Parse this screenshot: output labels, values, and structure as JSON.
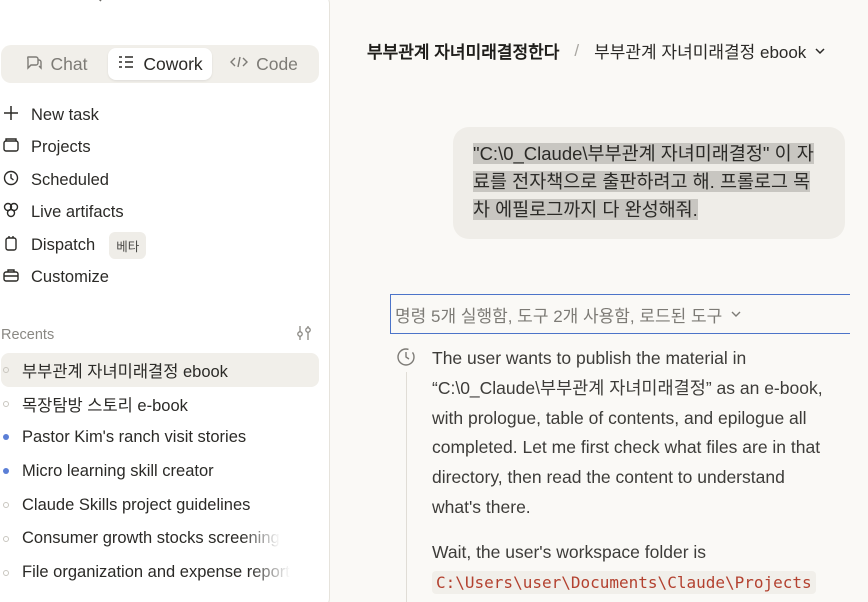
{
  "sidebar": {
    "modes": [
      {
        "label": "Chat",
        "icon": "chat-bubble-icon"
      },
      {
        "label": "Cowork",
        "icon": "cowork-icon"
      },
      {
        "label": "Code",
        "icon": "code-icon"
      }
    ],
    "active_mode": "Cowork",
    "nav": [
      {
        "label": "New task",
        "icon": "plus-icon"
      },
      {
        "label": "Projects",
        "icon": "folder-icon"
      },
      {
        "label": "Scheduled",
        "icon": "clock-icon"
      },
      {
        "label": "Live artifacts",
        "icon": "artifacts-icon"
      },
      {
        "label": "Dispatch",
        "icon": "dispatch-icon",
        "badge": "베타"
      },
      {
        "label": "Customize",
        "icon": "briefcase-icon"
      }
    ],
    "recents_label": "Recents",
    "recents": [
      {
        "label": "부부관계 자녀미래결정 ebook",
        "status": "idle",
        "active": true
      },
      {
        "label": "목장탐방 스토리 e-book",
        "status": "idle"
      },
      {
        "label": "Pastor Kim's ranch visit stories",
        "status": "unread"
      },
      {
        "label": "Micro learning skill creator",
        "status": "unread"
      },
      {
        "label": "Claude Skills project guidelines",
        "status": "idle"
      },
      {
        "label": "Consumer growth stocks screening",
        "status": "idle"
      },
      {
        "label": "File organization and expense report",
        "status": "idle"
      }
    ]
  },
  "breadcrumb": {
    "project": "부부관계 자녀미래결정한다",
    "separator": "/",
    "chat": "부부관계 자녀미래결정 ebook"
  },
  "user_message": {
    "text": "\"C:\\0_Claude\\부부관계 자녀미래결정\" 이 자료를 전자책으로 출판하려고 해. 프롤로그 목차 에필로그까지 다 완성해줘."
  },
  "assistant": {
    "tools_summary": "명령 5개 실행함, 도구 2개 사용함, 로드된 도구",
    "thinking_p1": "The user wants to publish the material in “C:\\0_Claude\\부부관계 자녀미래결정” as an e-book, with prologue, table of contents, and epilogue all completed. Let me first check what files are in that directory, then read the content to understand what's there.",
    "thinking_p2_prefix": "Wait, the user's workspace folder is",
    "thinking_p2_code": "C:\\Users\\user\\Documents\\Claude\\Projects"
  },
  "colors": {
    "accent_blue": "#4c74c9",
    "unread_dot": "#5b7fd6",
    "code_text": "#b3412f"
  }
}
